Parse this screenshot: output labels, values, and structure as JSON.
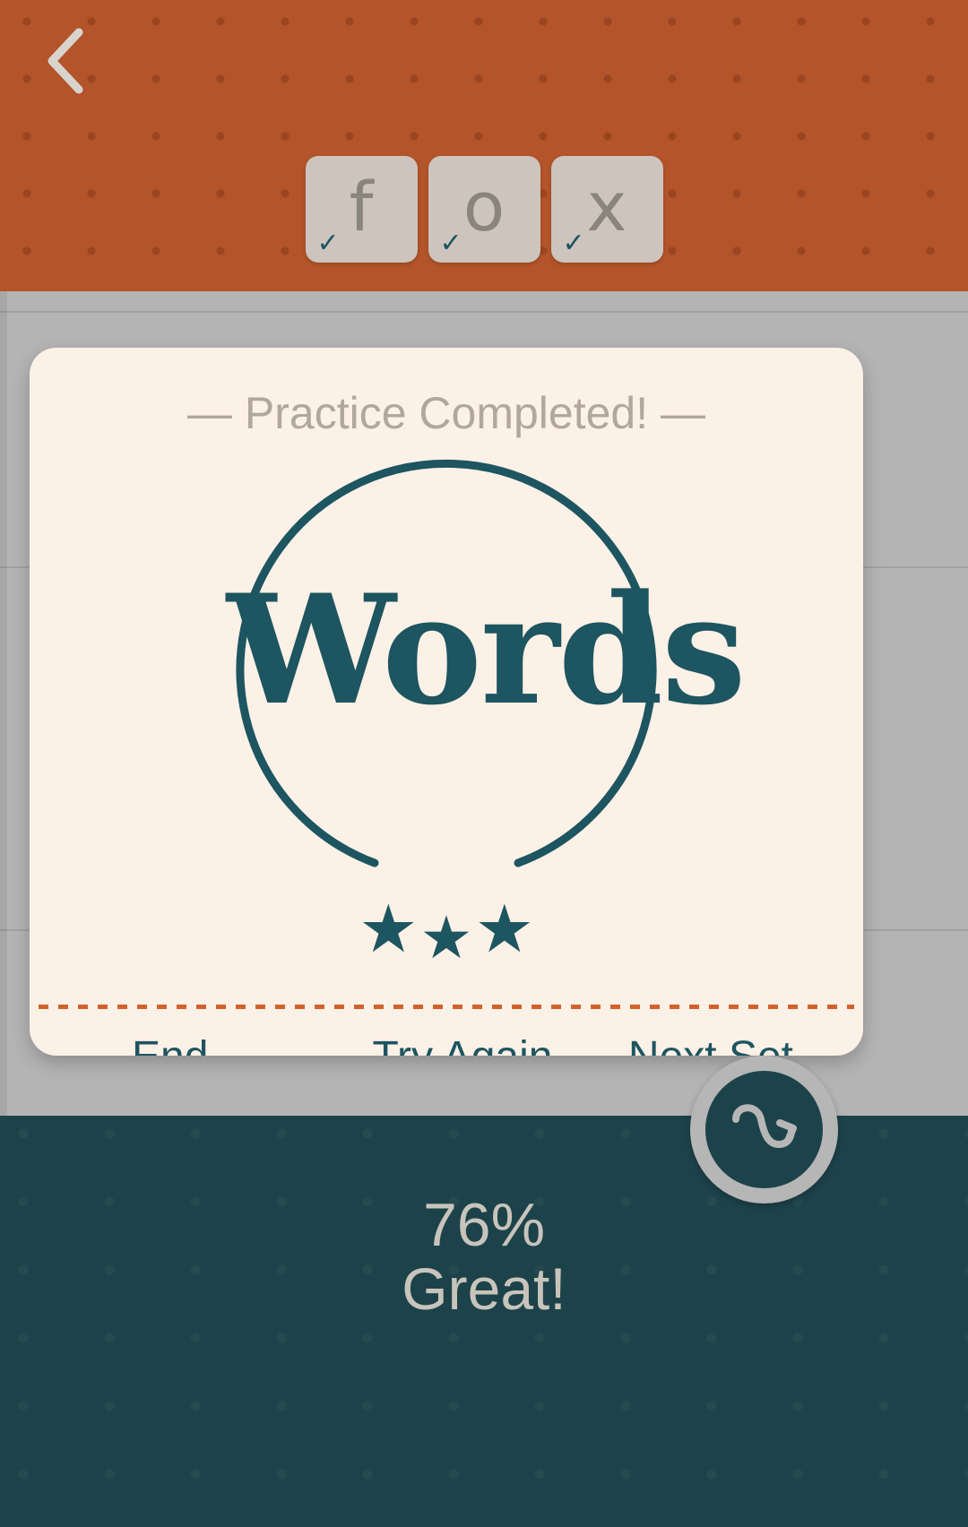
{
  "top_banner": {
    "background_color": "#b3542a",
    "back_button": {
      "icon": "chevron-left-icon",
      "label": "Back"
    },
    "tiles": [
      {
        "letter": "f",
        "check": "✓",
        "completed": true
      },
      {
        "letter": "o",
        "check": "✓",
        "completed": true
      },
      {
        "letter": "x",
        "check": "✓",
        "completed": true
      }
    ]
  },
  "modal": {
    "title": "— Practice Completed! —",
    "title_color": "#b2a79b",
    "card_color": "#fcf1e7",
    "badge": {
      "logo_text": "Words",
      "logo_color": "#1d5560",
      "stars": [
        "★",
        "★",
        "★"
      ],
      "star_count": 3
    },
    "divider_color": "#d2622c",
    "actions": [
      {
        "label": "End",
        "name": "end-button"
      },
      {
        "label": "Try Again",
        "name": "try-again-button"
      },
      {
        "label": "Next Set",
        "name": "next-set-button"
      }
    ],
    "action_color": "#1d5560"
  },
  "bottom_panel": {
    "background_color": "#1d434a",
    "score_percent": "76%",
    "score_label": "Great!",
    "text_color": "#c8c4bc",
    "fab": {
      "icon": "shuffle-wave-arrow-icon",
      "ring_color": "#b6b6b6"
    }
  }
}
